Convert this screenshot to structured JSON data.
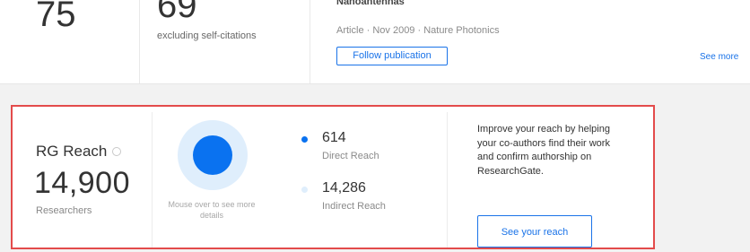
{
  "top_stats": {
    "citations_value": "75",
    "self_citations_value": "69",
    "self_citations_caption": "excluding self-citations",
    "publication_title": "Nanoantennas",
    "publication_meta": "Article · Nov 2009 · Nature Photonics",
    "follow_button_label": "Follow publication",
    "see_more_label": "See more"
  },
  "rg_reach": {
    "label": "RG Reach",
    "total_value": "14,900",
    "total_unit": "Researchers",
    "chart_hint": "Mouse over to see more details",
    "legend": [
      {
        "value": "614",
        "label": "Direct Reach",
        "color": "#0a72f0"
      },
      {
        "value": "14,286",
        "label": "Indirect Reach",
        "color": "#dfeefc"
      }
    ],
    "promo_text": "Improve your reach by helping your co-authors find their work and confirm authorship on ResearchGate.",
    "cta_label": "See your reach"
  },
  "colors": {
    "highlight_border": "#e34b4b",
    "accent_blue": "#1a73e8"
  }
}
